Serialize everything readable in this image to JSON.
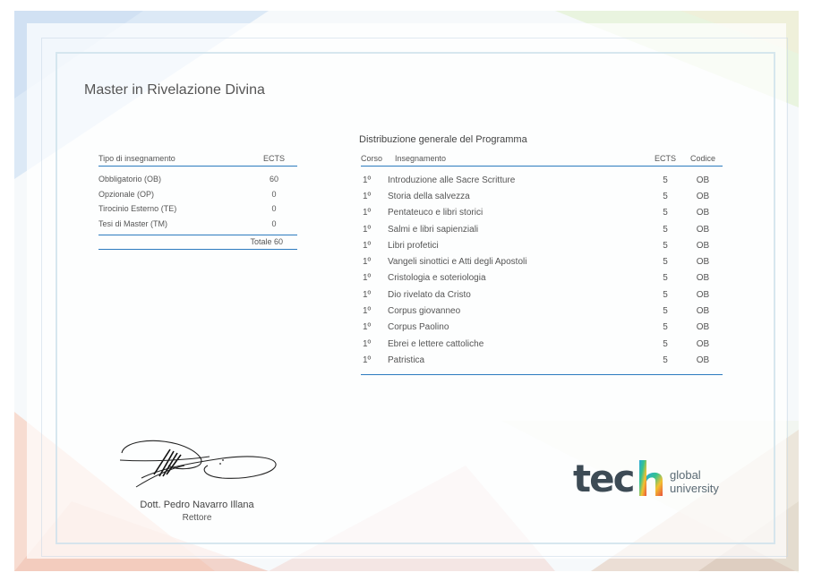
{
  "document_title": "Master in Rivelazione Divina",
  "type_table": {
    "header": [
      "Tipo di insegnamento",
      "ECTS"
    ],
    "rows": [
      {
        "type": "Obbligatorio (OB)",
        "ects": "60"
      },
      {
        "type": "Opzionale (OP)",
        "ects": "0"
      },
      {
        "type": "Tirocinio Esterno (TE)",
        "ects": "0"
      },
      {
        "type": "Tesi di Master (TM)",
        "ects": "0"
      }
    ],
    "total": "Totale 60"
  },
  "programme": {
    "title": "Distribuzione generale del Programma",
    "header": [
      "Corso",
      "Insegnamento",
      "ECTS",
      "Codice"
    ],
    "rows": [
      {
        "course": "1º",
        "subject": "Introduzione alle Sacre Scritture",
        "ects": "5",
        "code": "OB"
      },
      {
        "course": "1º",
        "subject": "Storia della salvezza",
        "ects": "5",
        "code": "OB"
      },
      {
        "course": "1º",
        "subject": "Pentateuco e libri storici",
        "ects": "5",
        "code": "OB"
      },
      {
        "course": "1º",
        "subject": "Salmi e libri sapienziali",
        "ects": "5",
        "code": "OB"
      },
      {
        "course": "1º",
        "subject": "Libri profetici",
        "ects": "5",
        "code": "OB"
      },
      {
        "course": "1º",
        "subject": "Vangeli sinottici e Atti degli Apostoli",
        "ects": "5",
        "code": "OB"
      },
      {
        "course": "1º",
        "subject": "Cristologia e soteriologia",
        "ects": "5",
        "code": "OB"
      },
      {
        "course": "1º",
        "subject": "Dio rivelato da Cristo",
        "ects": "5",
        "code": "OB"
      },
      {
        "course": "1º",
        "subject": "Corpus giovanneo",
        "ects": "5",
        "code": "OB"
      },
      {
        "course": "1º",
        "subject": "Corpus Paolino",
        "ects": "5",
        "code": "OB"
      },
      {
        "course": "1º",
        "subject": "Ebrei e lettere cattoliche",
        "ects": "5",
        "code": "OB"
      },
      {
        "course": "1º",
        "subject": "Patristica",
        "ects": "5",
        "code": "OB"
      }
    ]
  },
  "signatory": {
    "name": "Dott. Pedro Navarro Illana",
    "role": "Rettore",
    "signature_icon": "handwritten-signature"
  },
  "logo": {
    "brand": "tech",
    "line1": "global",
    "line2": "university",
    "icon": "tech-logo"
  },
  "colors": {
    "accent_line": "#2c7bbf",
    "logo_text": "#3d4b55"
  }
}
